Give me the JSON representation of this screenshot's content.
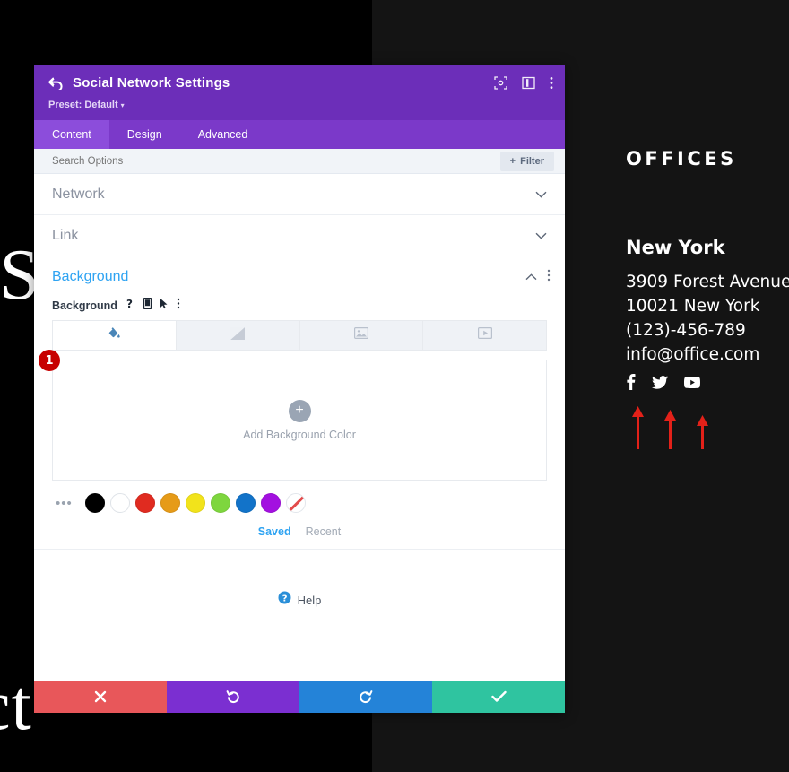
{
  "page": {
    "ghost_text_top": "e S",
    "ghost_text_bottom": "ct",
    "bg_left_color": "#000000",
    "bg_right_color": "#141414"
  },
  "offices": {
    "heading": "OFFICES",
    "city": "New York",
    "address_lines": [
      "3909 Forest Avenue",
      "10021 New York",
      "(123)-456-789",
      "info@office.com"
    ],
    "social_icons": [
      "facebook-icon",
      "twitter-icon",
      "youtube-icon"
    ],
    "arrow_color": "#e32119",
    "arrow_count": 3
  },
  "modal": {
    "title": "Social Network Settings",
    "preset": "Preset: Default",
    "back_icon": "back-arrow-icon",
    "header_icons": [
      "fullscreen-icon",
      "layout-panel-icon",
      "more-vertical-icon"
    ],
    "accent_purple": "#6c2eb9",
    "tabs": [
      {
        "label": "Content",
        "active": true
      },
      {
        "label": "Design",
        "active": false
      },
      {
        "label": "Advanced",
        "active": false
      }
    ],
    "search": {
      "placeholder": "Search Options",
      "value": ""
    },
    "filter_button": {
      "label": "Filter",
      "plus": "+"
    },
    "accordions": [
      {
        "label": "Network",
        "open": false
      },
      {
        "label": "Link",
        "open": false
      }
    ],
    "background_section": {
      "title": "Background",
      "collapse_icon": "chevron-up-icon",
      "more_icon": "more-vertical-icon",
      "field_label": "Background",
      "field_icons": [
        "help-question-icon",
        "responsive-mobile-icon",
        "hover-cursor-icon",
        "more-vertical-icon"
      ],
      "type_tabs": [
        {
          "name": "background-color-tab",
          "icon": "paint-bucket-icon",
          "active": true
        },
        {
          "name": "background-gradient-tab",
          "icon": "gradient-icon",
          "active": false
        },
        {
          "name": "background-image-tab",
          "icon": "image-icon",
          "active": false
        },
        {
          "name": "background-video-tab",
          "icon": "video-icon",
          "active": false
        }
      ],
      "dropzone": {
        "label": "Add Background Color",
        "plus": "+"
      },
      "marker_number": "1",
      "marker_color": "#c70000",
      "dots_label": "•••",
      "swatches": [
        {
          "name": "swatch-black",
          "color": "#000000"
        },
        {
          "name": "swatch-white",
          "color": "#ffffff"
        },
        {
          "name": "swatch-red",
          "color": "#e02b20"
        },
        {
          "name": "swatch-orange",
          "color": "#e69b18"
        },
        {
          "name": "swatch-yellow",
          "color": "#f2e31b"
        },
        {
          "name": "swatch-green",
          "color": "#7ed63e"
        },
        {
          "name": "swatch-blue",
          "color": "#1273c9"
        },
        {
          "name": "swatch-purple",
          "color": "#a310e0"
        },
        {
          "name": "swatch-transparent",
          "color": "transparent"
        }
      ],
      "palette_tabs": [
        {
          "label": "Saved",
          "active": true
        },
        {
          "label": "Recent",
          "active": false
        }
      ]
    },
    "help": {
      "label": "Help",
      "icon": "help-circle-icon"
    },
    "actions": [
      {
        "name": "discard-button",
        "icon": "close-x-icon",
        "color": "#e8575a"
      },
      {
        "name": "undo-button",
        "icon": "undo-icon",
        "color": "#7b2fd1"
      },
      {
        "name": "redo-button",
        "icon": "redo-icon",
        "color": "#2483d8"
      },
      {
        "name": "save-button",
        "icon": "check-icon",
        "color": "#2fc4a0"
      }
    ]
  }
}
